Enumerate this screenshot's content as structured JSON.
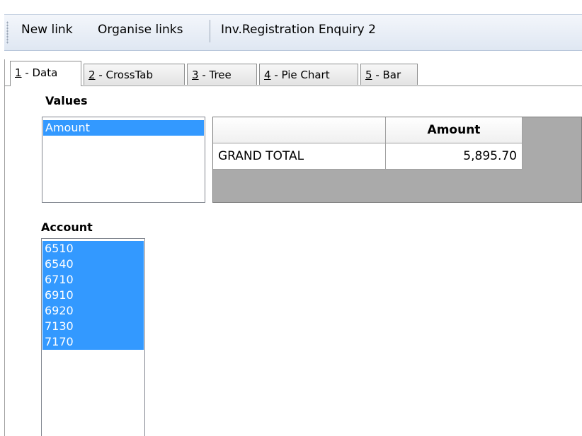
{
  "toolbar": {
    "new_link": "New link",
    "organise_links": "Organise links",
    "title": "Inv.Registration Enquiry 2"
  },
  "tabs": [
    {
      "key": "1",
      "label": " - Data",
      "active": true
    },
    {
      "key": "2",
      "label": " - CrossTab",
      "active": false
    },
    {
      "key": "3",
      "label": " - Tree",
      "active": false
    },
    {
      "key": "4",
      "label": " - Pie Chart",
      "active": false
    },
    {
      "key": "5",
      "label": " - Bar",
      "active": false
    }
  ],
  "values_panel": {
    "label": "Values",
    "items": [
      "Amount"
    ]
  },
  "grid": {
    "header": "Amount",
    "row_label": "GRAND TOTAL",
    "row_value": "5,895.70"
  },
  "account_panel": {
    "label": "Account",
    "items": [
      "6510",
      "6540",
      "6710",
      "6910",
      "6920",
      "7130",
      "7170"
    ]
  },
  "colors": {
    "selection": "#3399ff",
    "grid_background": "#aaaaaa",
    "toolbar_gradient_top": "#f3f6fb",
    "toolbar_gradient_bottom": "#dfe7f2"
  }
}
